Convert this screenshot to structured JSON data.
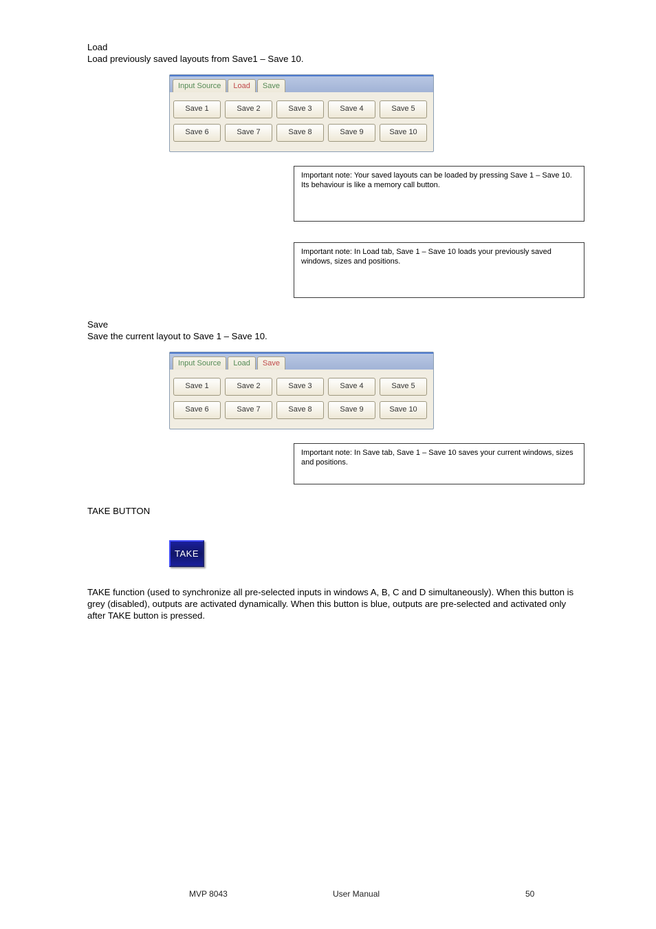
{
  "sectionLabel": "Load",
  "loadDesc": "Load previously saved layouts from Save1 – Save 10.",
  "panelA": {
    "tabs": [
      "Input Source",
      "Load",
      "Save"
    ],
    "selected": 1,
    "row1": [
      "Save 1",
      "Save 2",
      "Save 3",
      "Save 4",
      "Save 5"
    ],
    "row2": [
      "Save 6",
      "Save 7",
      "Save 8",
      "Save 9",
      "Save 10"
    ]
  },
  "box1": "Important note: Your saved layouts can be loaded by pressing Save 1 – Save 10. Its behaviour is like a memory call button.",
  "box2": "Important note: In Load tab, Save 1 – Save 10 loads your previously saved windows, sizes and positions.",
  "saveHeading": "Save",
  "saveDesc": "Save the current layout to Save 1 – Save 10.",
  "panelB": {
    "tabs": [
      "Input Source",
      "Load",
      "Save"
    ],
    "selected": 2,
    "row1": [
      "Save 1",
      "Save 2",
      "Save 3",
      "Save 4",
      "Save 5"
    ],
    "row2": [
      "Save 6",
      "Save 7",
      "Save 8",
      "Save 9",
      "Save 10"
    ]
  },
  "box3": "Important note: In Save tab, Save 1 – Save 10 saves your current windows, sizes and positions.",
  "takeHeading": "TAKE BUTTON",
  "takeLabel": "TAKE",
  "takeDesc": "TAKE function (used to synchronize all pre-selected inputs in windows A, B, C and D simultaneously). When this button is grey (disabled), outputs are activated dynamically. When this button is blue, outputs are pre-selected and activated only after TAKE button is pressed.",
  "footer": {
    "left": "MVP 8043",
    "center": "User Manual",
    "page": "50"
  }
}
